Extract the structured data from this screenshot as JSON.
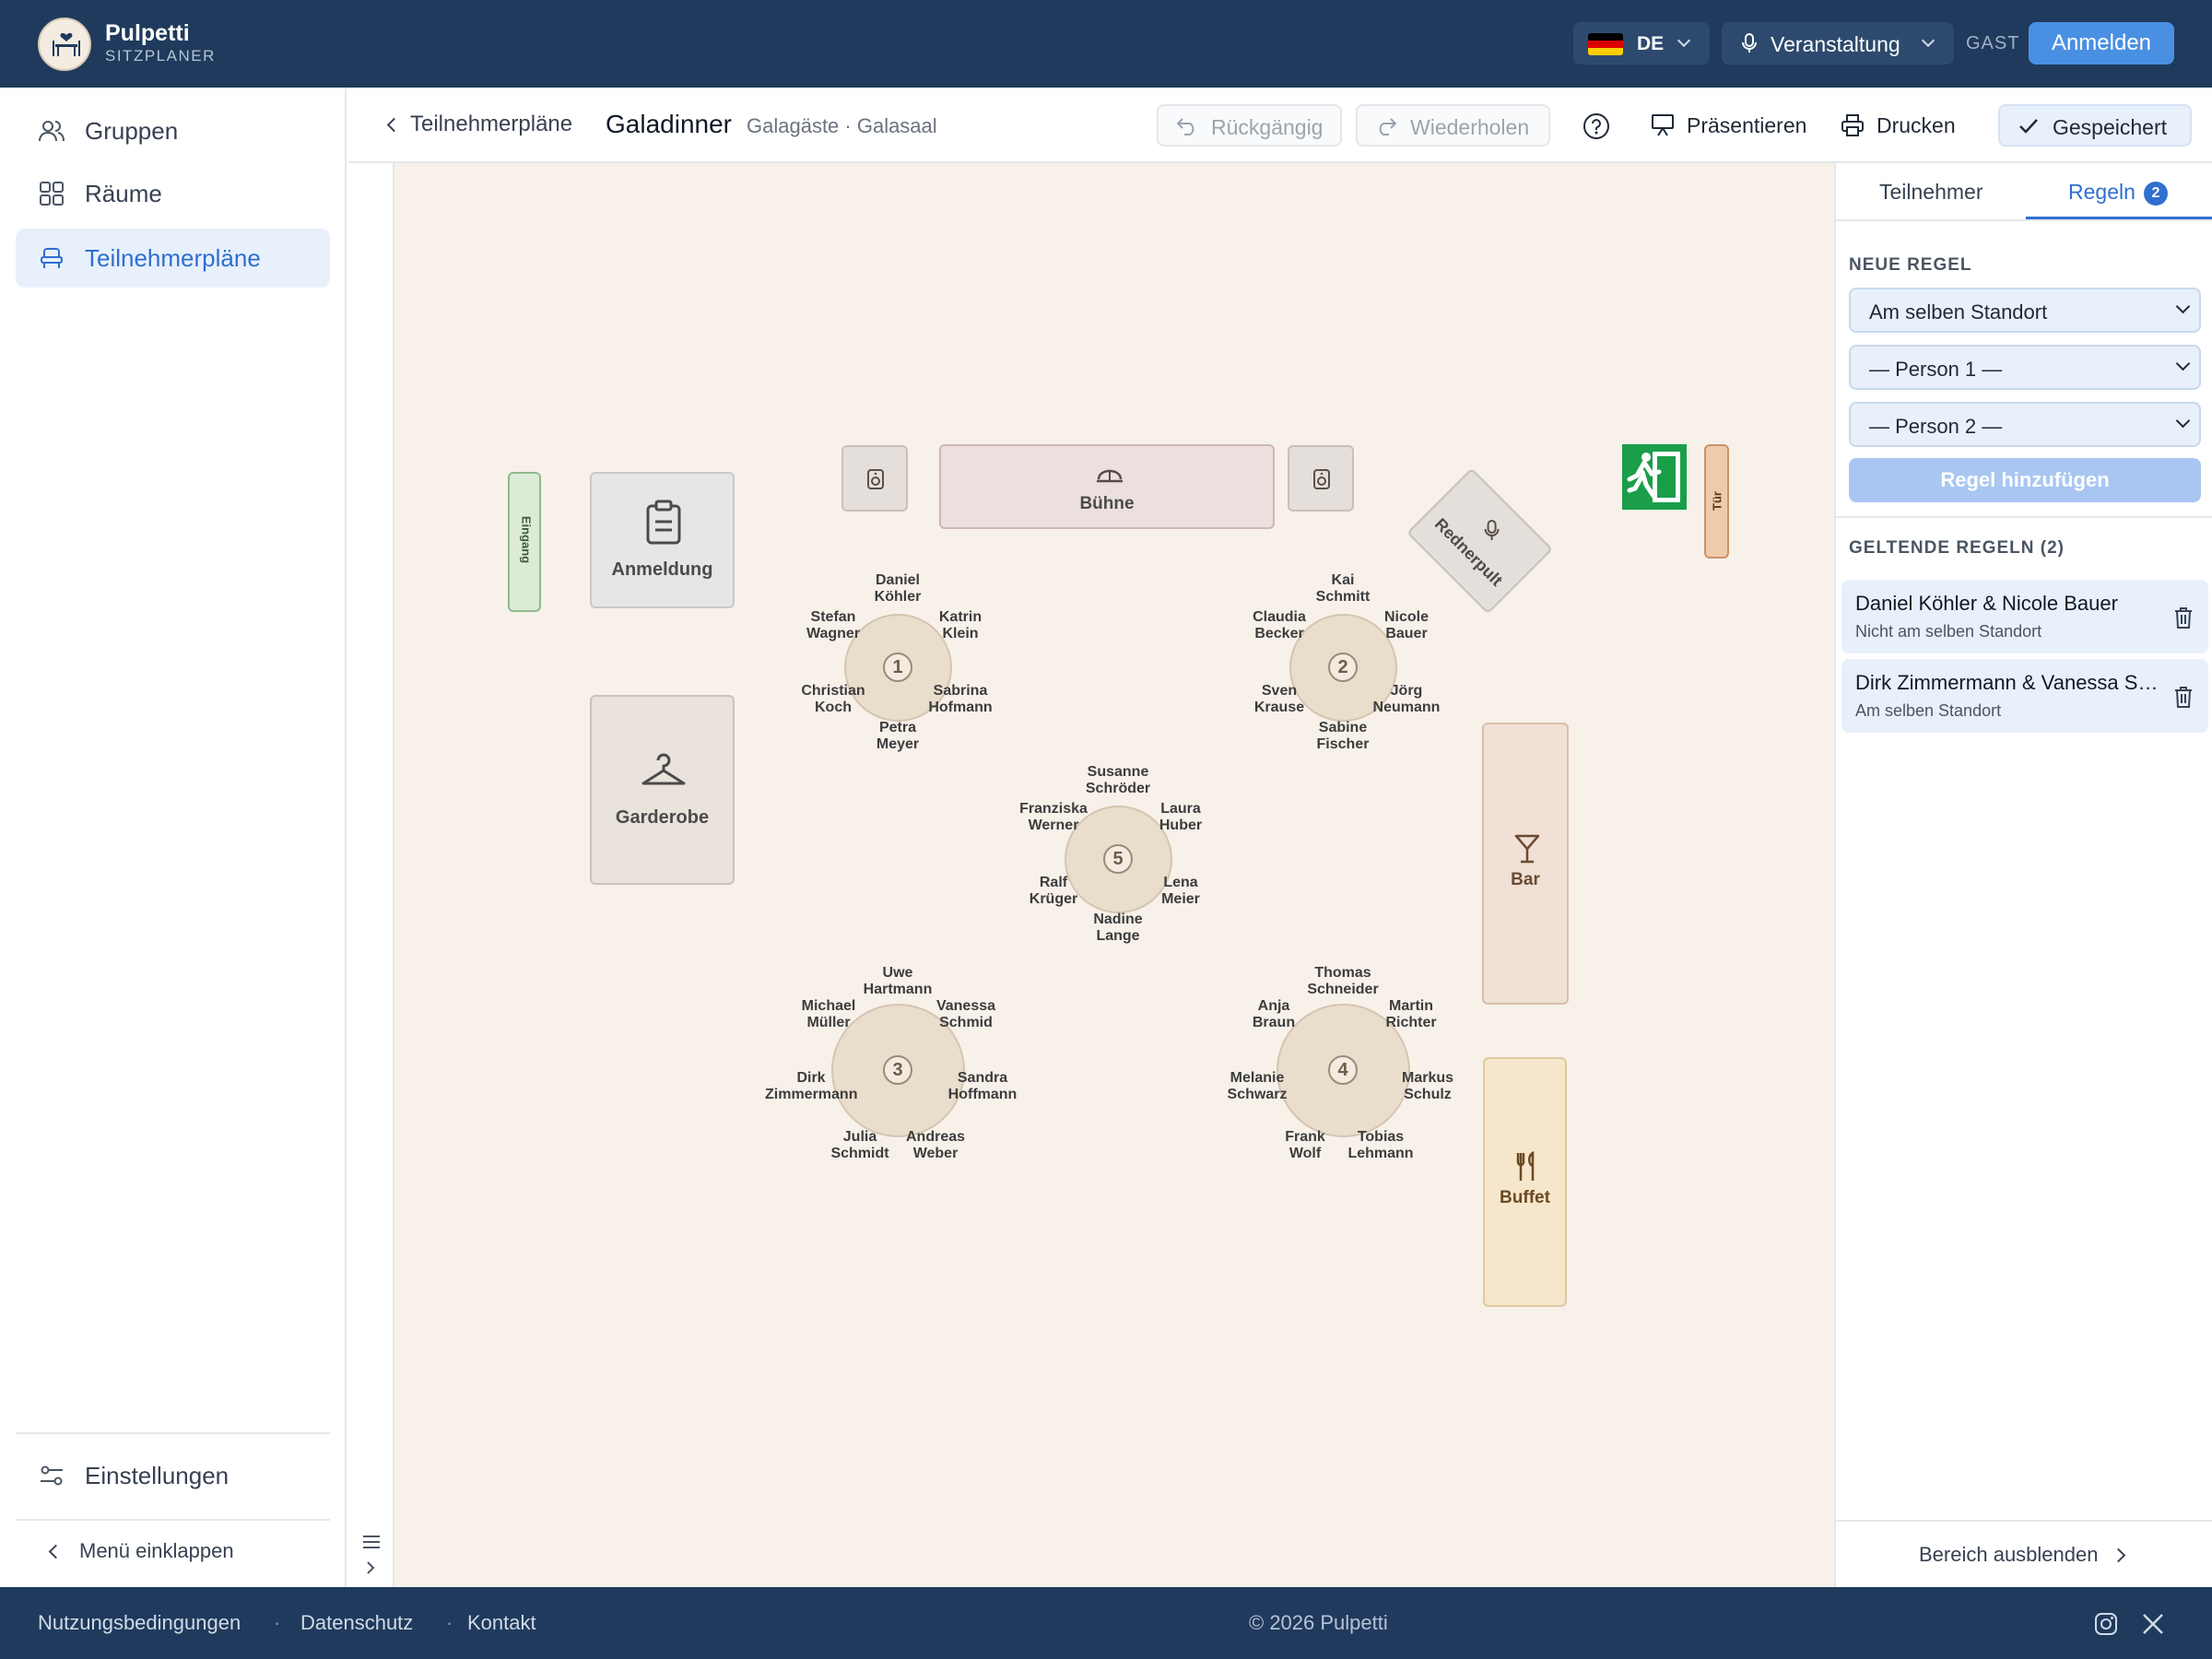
{
  "app": {
    "brand_name": "Pulpetti",
    "brand_sub": "SITZPLANER",
    "language": "DE",
    "event_mode": "Veranstaltung",
    "guest_label": "GAST",
    "login_label": "Anmelden"
  },
  "sidebar": {
    "items": [
      {
        "label": "Gruppen",
        "icon": "users-icon"
      },
      {
        "label": "Räume",
        "icon": "grid-icon"
      },
      {
        "label": "Teilnehmerpläne",
        "icon": "seat-icon"
      }
    ],
    "settings_label": "Einstellungen",
    "collapse_label": "Menü einklappen"
  },
  "toolbar": {
    "back_label": "Teilnehmerpläne",
    "title": "Galadinner",
    "subtitle": "Galagäste · Galasaal",
    "undo_label": "Rückgängig",
    "redo_label": "Wiederholen",
    "present_label": "Präsentieren",
    "print_label": "Drucken",
    "saved_label": "Gespeichert"
  },
  "canvas": {
    "entrance": "Eingang",
    "registration": "Anmeldung",
    "stage": "Bühne",
    "lectern": "Rednerpult",
    "wardrobe": "Garderobe",
    "bar": "Bar",
    "buffet": "Buffet",
    "door": "Tür",
    "tables": [
      {
        "number": "1",
        "guests": [
          {
            "first": "Daniel",
            "last": "Köhler"
          },
          {
            "first": "Katrin",
            "last": "Klein"
          },
          {
            "first": "Sabrina",
            "last": "Hofmann"
          },
          {
            "first": "Petra",
            "last": "Meyer"
          },
          {
            "first": "Christian",
            "last": "Koch"
          },
          {
            "first": "Stefan",
            "last": "Wagner"
          }
        ]
      },
      {
        "number": "2",
        "guests": [
          {
            "first": "Kai",
            "last": "Schmitt"
          },
          {
            "first": "Nicole",
            "last": "Bauer"
          },
          {
            "first": "Jörg",
            "last": "Neumann"
          },
          {
            "first": "Sabine",
            "last": "Fischer"
          },
          {
            "first": "Sven",
            "last": "Krause"
          },
          {
            "first": "Claudia",
            "last": "Becker"
          }
        ]
      },
      {
        "number": "5",
        "guests": [
          {
            "first": "Susanne",
            "last": "Schröder"
          },
          {
            "first": "Laura",
            "last": "Huber"
          },
          {
            "first": "Lena",
            "last": "Meier"
          },
          {
            "first": "Nadine",
            "last": "Lange"
          },
          {
            "first": "Ralf",
            "last": "Krüger"
          },
          {
            "first": "Franziska",
            "last": "Werner"
          }
        ]
      },
      {
        "number": "3",
        "guests": [
          {
            "first": "Uwe",
            "last": "Hartmann"
          },
          {
            "first": "Vanessa",
            "last": "Schmid"
          },
          {
            "first": "Sandra",
            "last": "Hoffmann"
          },
          {
            "first": "Andreas",
            "last": "Weber"
          },
          {
            "first": "Julia",
            "last": "Schmidt"
          },
          {
            "first": "Dirk",
            "last": "Zimmermann"
          },
          {
            "first": "Michael",
            "last": "Müller"
          }
        ]
      },
      {
        "number": "4",
        "guests": [
          {
            "first": "Thomas",
            "last": "Schneider"
          },
          {
            "first": "Martin",
            "last": "Richter"
          },
          {
            "first": "Markus",
            "last": "Schulz"
          },
          {
            "first": "Tobias",
            "last": "Lehmann"
          },
          {
            "first": "Frank",
            "last": "Wolf"
          },
          {
            "first": "Melanie",
            "last": "Schwarz"
          },
          {
            "first": "Anja",
            "last": "Braun"
          }
        ]
      }
    ]
  },
  "panel": {
    "tab_participants": "Teilnehmer",
    "tab_rules": "Regeln",
    "rules_count": "2",
    "new_rule_title": "NEUE REGEL",
    "rule_type": "Am selben Standort",
    "person1_placeholder": "— Person 1 —",
    "person2_placeholder": "— Person 2 —",
    "add_rule_label": "Regel hinzufügen",
    "active_rules_title": "GELTENDE REGELN (2)",
    "rules": [
      {
        "title": "Daniel Köhler & Nicole Bauer",
        "type": "Nicht am selben Standort"
      },
      {
        "title": "Dirk Zimmermann & Vanessa Schmid",
        "type": "Am selben Standort"
      }
    ],
    "hide_label": "Bereich ausblenden"
  },
  "footer": {
    "links": [
      "Nutzungsbedingungen",
      "Datenschutz",
      "Kontakt"
    ],
    "copyright": "© 2026 Pulpetti"
  },
  "colors": {
    "header_bg": "#1f3a5c",
    "accent": "#2f6fd0",
    "canvas_bg": "#f7f1ea",
    "exit_sign": "#1a9e4a"
  }
}
